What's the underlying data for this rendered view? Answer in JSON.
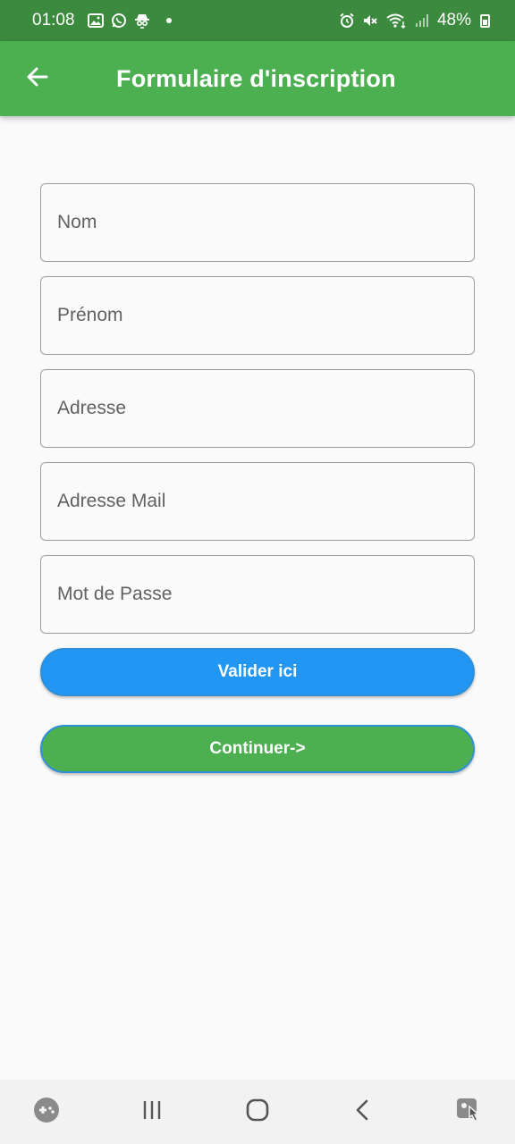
{
  "status_bar": {
    "time": "01:08",
    "battery": "48%",
    "icons": [
      "gallery-icon",
      "whatsapp-icon",
      "incognito-icon",
      "notification-dot",
      "alarm-icon",
      "mute-icon",
      "wifi-icon",
      "signal-icon",
      "battery-icon"
    ]
  },
  "app_bar": {
    "back_icon": "arrow-left-icon",
    "title": "Formulaire d'inscription",
    "color": "#4caf50"
  },
  "form": {
    "fields": [
      {
        "placeholder": "Nom",
        "value": ""
      },
      {
        "placeholder": "Prénom",
        "value": ""
      },
      {
        "placeholder": "Adresse",
        "value": ""
      },
      {
        "placeholder": "Adresse Mail",
        "value": ""
      },
      {
        "placeholder": "Mot de Passe",
        "value": ""
      }
    ],
    "submit_label": "Valider ici",
    "submit_color": "#2196f3",
    "continue_label": "Continuer->",
    "continue_color": "#4caf50"
  },
  "nav_bar": {
    "icons": [
      "game-launcher-icon",
      "recent-apps-icon",
      "home-icon",
      "back-icon",
      "assistant-icon"
    ]
  }
}
